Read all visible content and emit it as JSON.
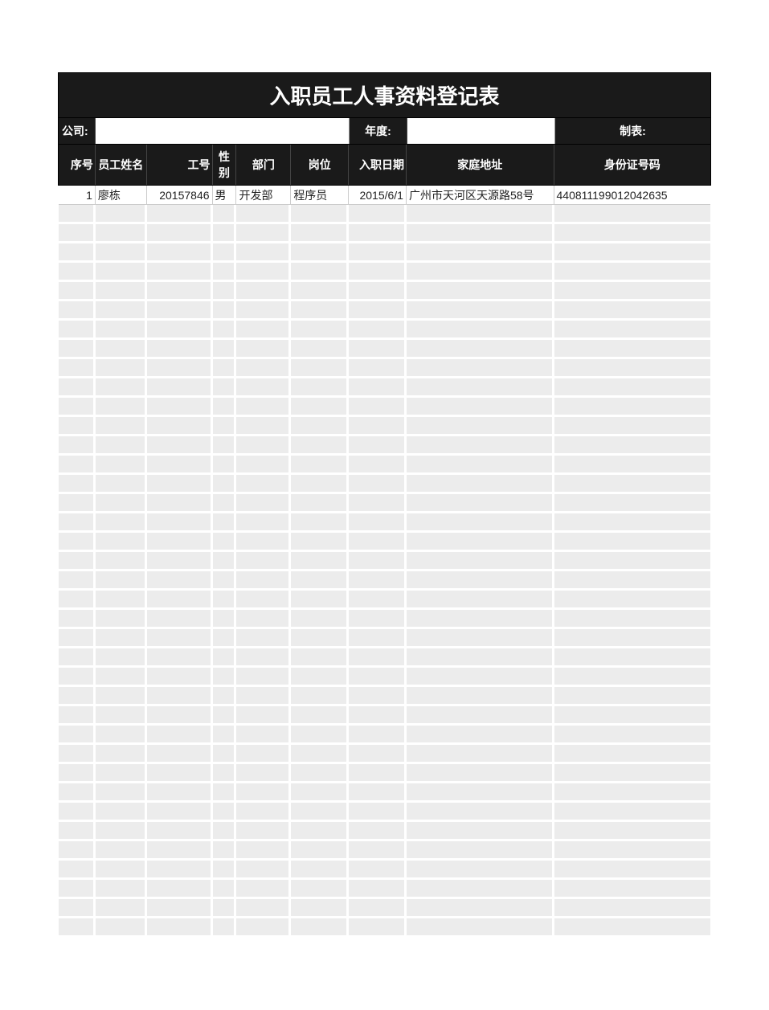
{
  "title": "入职员工人事资料登记表",
  "meta": {
    "company_label": "公司:",
    "company_value": "",
    "year_label": "年度:",
    "year_value": "",
    "preparer_label": "制表:"
  },
  "columns": [
    "序号",
    "员工姓名",
    "工号",
    "性别",
    "部门",
    "岗位",
    "入职日期",
    "家庭地址",
    "身份证号码"
  ],
  "rows": [
    {
      "seq": "1",
      "name": "廖栋",
      "empno": "20157846",
      "gender": "男",
      "dept": "开发部",
      "pos": "程序员",
      "date": "2015/6/1",
      "addr": "广州市天河区天源路58号",
      "id": "440811199012042635"
    }
  ],
  "empty_row_count": 38
}
